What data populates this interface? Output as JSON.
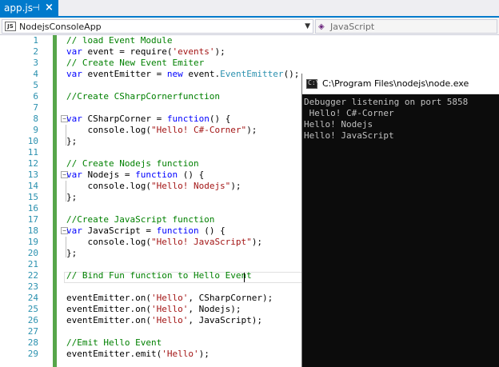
{
  "tab": {
    "label": "app.js",
    "pin_glyph": "⊣",
    "close_glyph": "×"
  },
  "navbar": {
    "project": "NodejsConsoleApp",
    "project_icon": "JS",
    "language": "JavaScript"
  },
  "editor": {
    "line_numbers": [
      "1",
      "2",
      "3",
      "4",
      "5",
      "6",
      "7",
      "8",
      "9",
      "10",
      "11",
      "12",
      "13",
      "14",
      "15",
      "16",
      "17",
      "18",
      "19",
      "20",
      "21",
      "22",
      "23",
      "24",
      "25",
      "26",
      "27",
      "28",
      "29"
    ]
  },
  "console": {
    "title": "C:\\Program Files\\nodejs\\node.exe",
    "icon_glyph": "C:\\",
    "lines": [
      "Debugger listening on port 5858",
      " Hello! C#-Corner",
      "Hello! Nodejs",
      "Hello! JavaScript"
    ]
  },
  "colors": {
    "accent": "#007acc",
    "keyword": "#0000ff",
    "comment": "#008000",
    "string": "#a31515",
    "type": "#2b91af",
    "change_bar": "#57a64a"
  }
}
